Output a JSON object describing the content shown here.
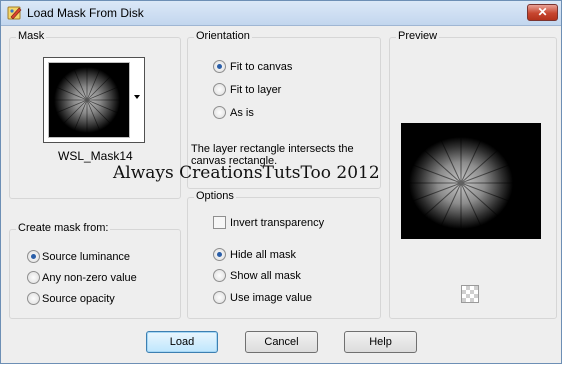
{
  "window": {
    "title": "Load Mask From Disk",
    "close_label": "✕"
  },
  "mask_group": {
    "label": "Mask",
    "selected_mask": "WSL_Mask14"
  },
  "orientation_group": {
    "label": "Orientation",
    "options": [
      {
        "label": "Fit to canvas",
        "checked": true
      },
      {
        "label": "Fit to layer",
        "checked": false
      },
      {
        "label": "As is",
        "checked": false
      }
    ],
    "info_line1": "The layer rectangle intersects the",
    "info_line2": "canvas rectangle."
  },
  "preview_group": {
    "label": "Preview"
  },
  "watermark": "Always CreationsTutsToo 2012",
  "create_mask_group": {
    "label": "Create mask from:",
    "options": [
      {
        "label": "Source luminance",
        "checked": true
      },
      {
        "label": "Any non-zero value",
        "checked": false
      },
      {
        "label": "Source opacity",
        "checked": false
      }
    ]
  },
  "options_group": {
    "label": "Options",
    "invert_label": "Invert transparency",
    "invert_checked": false,
    "mask_options": [
      {
        "label": "Hide all mask",
        "checked": true
      },
      {
        "label": "Show all mask",
        "checked": false
      },
      {
        "label": "Use image value",
        "checked": false
      }
    ]
  },
  "buttons": {
    "load": "Load",
    "cancel": "Cancel",
    "help": "Help"
  }
}
